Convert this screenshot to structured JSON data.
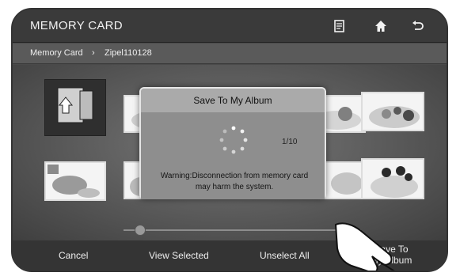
{
  "header": {
    "title": "MEMORY CARD",
    "icons": [
      "notes-icon",
      "home-icon",
      "back-icon"
    ]
  },
  "breadcrumb": {
    "items": [
      "Memory Card",
      "Zipel110128"
    ]
  },
  "dialog": {
    "title": "Save To My Album",
    "counter": "1/10",
    "warning_line1": "Warning:Disconnection from memory card",
    "warning_line2": "may harm the system."
  },
  "bottom_bar": {
    "cancel": "Cancel",
    "view_selected": "View Selected",
    "unselect_all": "Unselect All",
    "save_to_line1": "Save To",
    "save_to_line2": "My Album"
  },
  "colors": {
    "header_bg": "#3a3a3a",
    "dialog_bg": "#9a9a9a",
    "text_light": "#f2f2f2"
  }
}
